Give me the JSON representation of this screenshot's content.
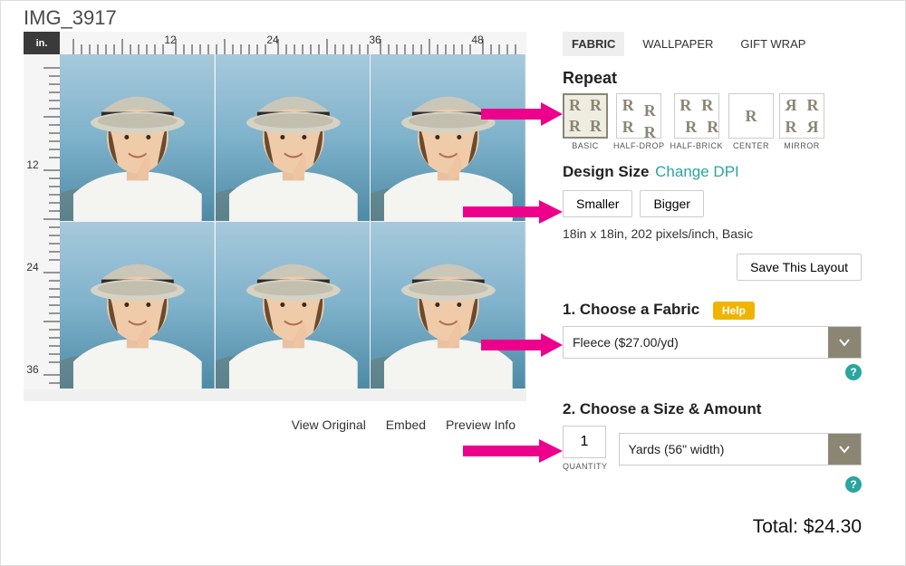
{
  "title": "IMG_3917",
  "ruler_unit": "in.",
  "ruler_h_marks": [
    "12",
    "24",
    "36",
    "48"
  ],
  "ruler_v_marks": [
    "12",
    "24",
    "36"
  ],
  "preview_links": {
    "view": "View Original",
    "embed": "Embed",
    "info": "Preview Info"
  },
  "tabs": {
    "fabric": "FABRIC",
    "wallpaper": "WALLPAPER",
    "giftwrap": "GIFT WRAP"
  },
  "repeat": {
    "label": "Repeat",
    "options": [
      {
        "key": "basic",
        "label": "BASIC"
      },
      {
        "key": "half-drop",
        "label": "HALF-DROP"
      },
      {
        "key": "half-brick",
        "label": "HALF-BRICK"
      },
      {
        "key": "center",
        "label": "CENTER"
      },
      {
        "key": "mirror",
        "label": "MIRROR"
      }
    ]
  },
  "design_size": {
    "label": "Design Size",
    "change_dpi": "Change DPI",
    "smaller": "Smaller",
    "bigger": "Bigger",
    "info": "18in x 18in, 202 pixels/inch, Basic",
    "save": "Save This Layout"
  },
  "step1": {
    "label": "1. Choose a Fabric",
    "help": "Help",
    "value": "Fleece ($27.00/yd)"
  },
  "step2": {
    "label": "2. Choose a Size & Amount",
    "qty_value": "1",
    "qty_label": "QUANTITY",
    "size_value": "Yards (56\" width)"
  },
  "total": "Total: $24.30"
}
